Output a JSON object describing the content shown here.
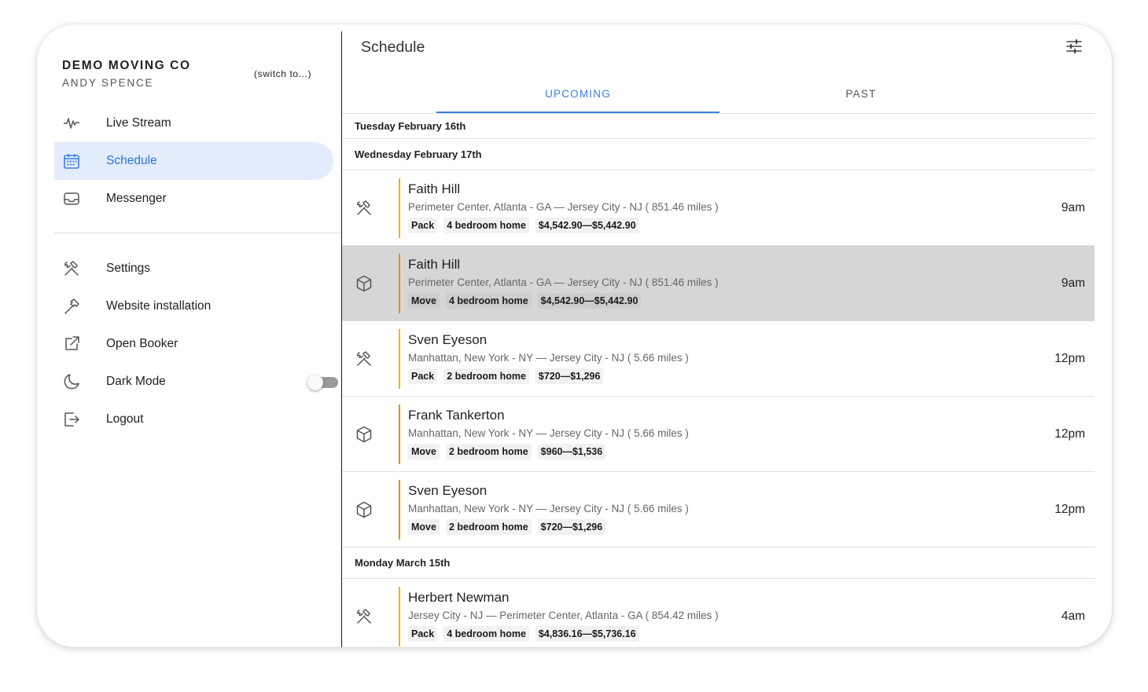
{
  "sidebar": {
    "company": "DEMO MOVING CO",
    "user": "ANDY SPENCE",
    "switch_label": "(switch to...)",
    "items": [
      {
        "label": "Live Stream",
        "icon": "pulse-icon"
      },
      {
        "label": "Schedule",
        "icon": "calendar-icon",
        "active": true
      },
      {
        "label": "Messenger",
        "icon": "inbox-icon"
      },
      {
        "label": "Settings",
        "icon": "tools-icon"
      },
      {
        "label": "Website installation",
        "icon": "hammer-icon"
      },
      {
        "label": "Open Booker",
        "icon": "external-link-icon"
      },
      {
        "label": "Dark Mode",
        "icon": "moon-icon",
        "toggle": false
      },
      {
        "label": "Logout",
        "icon": "logout-icon"
      }
    ]
  },
  "header": {
    "title": "Schedule",
    "filter_icon": "sliders-icon"
  },
  "tabs": [
    {
      "label": "UPCOMING",
      "active": true
    },
    {
      "label": "PAST",
      "active": false
    }
  ],
  "colors": {
    "accent": "#3a7ee0",
    "pack_bar": "#f5b100",
    "move_bar": "#f08a00",
    "selected_row": "#d6d6d6"
  },
  "days": [
    {
      "label": "Tuesday February 16th",
      "jobs": []
    },
    {
      "label": "Wednesday February 17th",
      "jobs": [
        {
          "name": "Faith Hill",
          "route": "Perimeter Center, Atlanta - GA — Jersey City - NJ ( 851.46 miles )",
          "type": "Pack",
          "size": "4 bedroom home",
          "price": "$4,542.90—$5,442.90",
          "time": "9am",
          "icon": "tools-icon",
          "selected": false
        },
        {
          "name": "Faith Hill",
          "route": "Perimeter Center, Atlanta - GA — Jersey City - NJ ( 851.46 miles )",
          "type": "Move",
          "size": "4 bedroom home",
          "price": "$4,542.90—$5,442.90",
          "time": "9am",
          "icon": "box-icon",
          "selected": true
        },
        {
          "name": "Sven Eyeson",
          "route": "Manhattan, New York - NY — Jersey City - NJ ( 5.66 miles )",
          "type": "Pack",
          "size": "2 bedroom home",
          "price": "$720—$1,296",
          "time": "12pm",
          "icon": "tools-icon",
          "selected": false
        },
        {
          "name": "Frank Tankerton",
          "route": "Manhattan, New York - NY — Jersey City - NJ ( 5.66 miles )",
          "type": "Move",
          "size": "2 bedroom home",
          "price": "$960—$1,536",
          "time": "12pm",
          "icon": "box-icon",
          "selected": false
        },
        {
          "name": "Sven Eyeson",
          "route": "Manhattan, New York - NY — Jersey City - NJ ( 5.66 miles )",
          "type": "Move",
          "size": "2 bedroom home",
          "price": "$720—$1,296",
          "time": "12pm",
          "icon": "box-icon",
          "selected": false
        }
      ]
    },
    {
      "label": "Monday March 15th",
      "jobs": [
        {
          "name": "Herbert Newman",
          "route": "Jersey City - NJ — Perimeter Center, Atlanta - GA ( 854.42 miles )",
          "type": "Pack",
          "size": "4 bedroom home",
          "price": "$4,836.16—$5,736.16",
          "time": "4am",
          "icon": "tools-icon",
          "selected": false
        }
      ]
    }
  ]
}
